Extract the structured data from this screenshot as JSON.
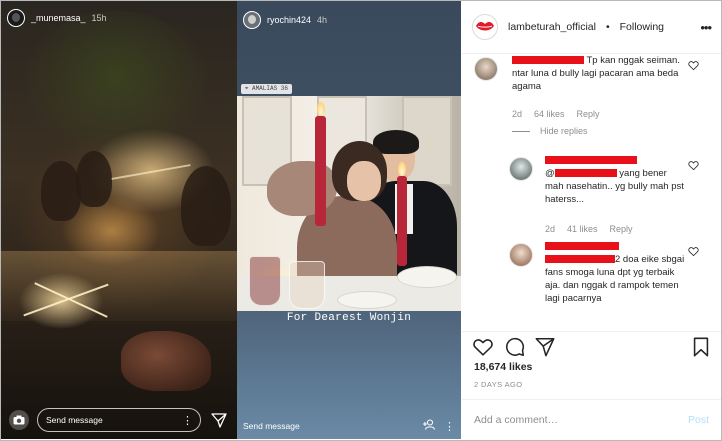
{
  "story_left": {
    "username": "_munemasa_",
    "time": "15h",
    "message_placeholder": "Send message"
  },
  "story_middle": {
    "username": "ryochin424",
    "time": "4h",
    "location_tag": "AMALIAS 36",
    "caption": "For Dearest Wonjin",
    "message_placeholder": "Send message"
  },
  "post": {
    "username": "lambeturah_official",
    "separator": "•",
    "follow_status": "Following",
    "comments": [
      {
        "text": "Tp kan nggak seiman. ntar luna d bully lagi pacaran ama beda agama",
        "age": "2d",
        "likes": "64 likes",
        "reply": "Reply",
        "hide_replies": "Hide replies"
      },
      {
        "text": "yang bener mah nasehatin.. yg bully mah pst haterss...",
        "text_prefix": "@",
        "age": "2d",
        "likes": "41 likes",
        "reply": "Reply"
      },
      {
        "text_suffix": "2 doa",
        "text": "eike sbgai fans smoga luna dpt yg terbaik aja. dan nggak d rampok temen lagi pacarnya"
      }
    ],
    "likes_count": "18,674 likes",
    "date": "2 DAYS AGO",
    "add_comment_placeholder": "Add a comment…",
    "post_button": "Post"
  },
  "colors": {
    "redaction": "#e8111a",
    "meta_gray": "#8e8e8e",
    "post_disabled": "#b2dffc"
  }
}
